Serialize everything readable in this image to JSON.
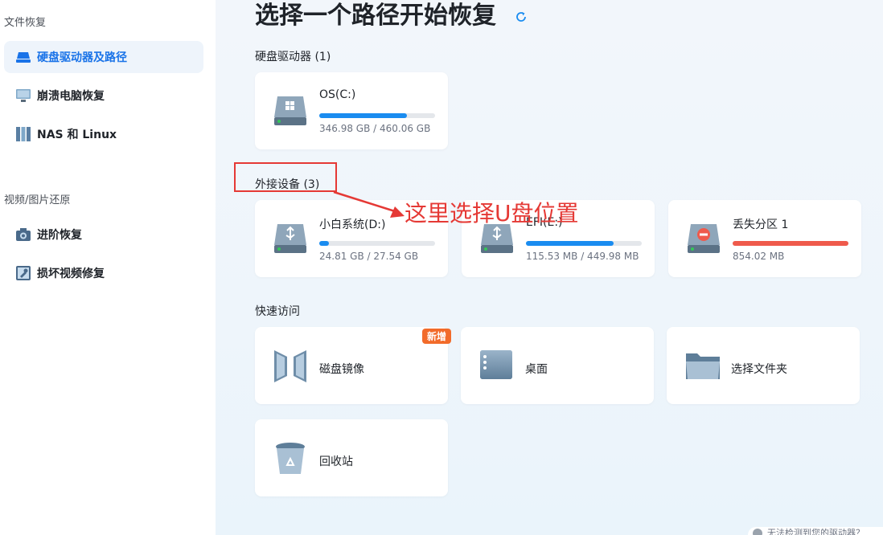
{
  "sidebar": {
    "section_file_recovery": "文件恢复",
    "section_media_restore": "视频/图片还原",
    "items": [
      {
        "label": "硬盘驱动器及路径",
        "icon": "drive-icon",
        "active": true
      },
      {
        "label": "崩溃电脑恢复",
        "icon": "monitor-icon"
      },
      {
        "label": "NAS 和 Linux",
        "icon": "nas-icon"
      },
      {
        "label": "进阶恢复",
        "icon": "camera-icon"
      },
      {
        "label": "损坏视频修复",
        "icon": "video-repair-icon"
      }
    ]
  },
  "main": {
    "title": "选择一个路径开始恢复",
    "hard_drives": {
      "title": "硬盘驱动器 (1)",
      "items": [
        {
          "name": "OS(C:)",
          "size": "346.98 GB / 460.06 GB",
          "usage": 0.754,
          "icon": "windows-drive-icon"
        }
      ]
    },
    "external": {
      "title": "外接设备 (3)",
      "items": [
        {
          "name": "小白系统(D:)",
          "size": "24.81 GB / 27.54 GB",
          "usage": 0.08,
          "icon": "usb-drive-icon"
        },
        {
          "name": "EFI(E:)",
          "size": "115.53 MB / 449.98 MB",
          "usage": 0.76,
          "icon": "usb-drive-icon"
        },
        {
          "name": "丢失分区 1",
          "size": "854.02 MB",
          "usage": 1.0,
          "icon": "lost-partition-icon"
        }
      ]
    },
    "quick_access": {
      "title": "快速访问",
      "items": [
        {
          "name": "磁盘镜像",
          "badge": "新增",
          "icon": "disk-image-icon"
        },
        {
          "name": "桌面",
          "icon": "desktop-icon"
        },
        {
          "name": "选择文件夹",
          "icon": "folder-icon"
        },
        {
          "name": "回收站",
          "icon": "recycle-bin-icon"
        }
      ]
    },
    "bottom_hint": "无法检测到您的驱动器？"
  },
  "annotation": {
    "text": "这里选择U盘位置"
  },
  "colors": {
    "accent": "#1a73e8",
    "bar_blue": "#1a8cf0",
    "bar_red": "#ef5a4c",
    "annotation_red": "#e53935",
    "badge_orange": "#f26b2a"
  }
}
